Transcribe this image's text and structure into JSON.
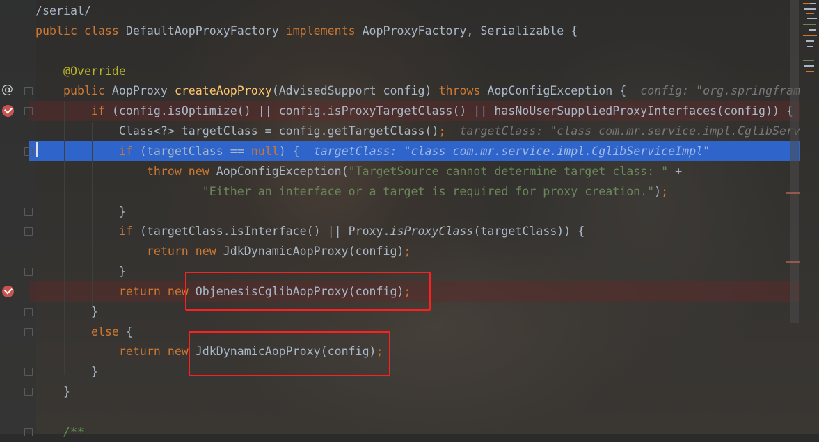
{
  "editor": {
    "lines": [
      {
        "id": "l0",
        "segments": [
          {
            "t": "/serial/",
            "c": "plain"
          }
        ]
      },
      {
        "id": "l1",
        "segments": [
          {
            "t": "public class ",
            "c": "kw"
          },
          {
            "t": "DefaultAopProxyFactory ",
            "c": "plain"
          },
          {
            "t": "implements ",
            "c": "kw"
          },
          {
            "t": "AopProxyFactory, Serializable {",
            "c": "plain"
          }
        ]
      },
      {
        "id": "l2",
        "segments": []
      },
      {
        "id": "l3",
        "segments": [
          {
            "t": "    ",
            "c": "plain"
          },
          {
            "t": "@Override",
            "c": "an"
          }
        ]
      },
      {
        "id": "l4",
        "segments": [
          {
            "t": "    ",
            "c": "plain"
          },
          {
            "t": "public ",
            "c": "kw"
          },
          {
            "t": "AopProxy ",
            "c": "plain"
          },
          {
            "t": "createAopProxy",
            "c": "fn"
          },
          {
            "t": "(AdvisedSupport config) ",
            "c": "plain"
          },
          {
            "t": "throws ",
            "c": "kw"
          },
          {
            "t": "AopConfigException {  ",
            "c": "plain"
          },
          {
            "t": "config: \"org.springfram",
            "c": "hint"
          }
        ]
      },
      {
        "id": "l5",
        "segments": [
          {
            "t": "        ",
            "c": "plain"
          },
          {
            "t": "if ",
            "c": "kw"
          },
          {
            "t": "(config.isOptimize() || config.isProxyTargetClass() || hasNoUserSuppliedProxyInterfaces(config)) {",
            "c": "plain"
          }
        ]
      },
      {
        "id": "l6",
        "segments": [
          {
            "t": "            Class<?> targetClass = config.getTargetClass()",
            "c": "plain"
          },
          {
            "t": ";",
            "c": "kw"
          },
          {
            "t": "  ",
            "c": "plain"
          },
          {
            "t": "targetClass: \"class com.mr.service.impl.CglibServ",
            "c": "hint"
          }
        ]
      },
      {
        "id": "l7",
        "segments": [
          {
            "t": "            ",
            "c": "plain"
          },
          {
            "t": "if ",
            "c": "kw"
          },
          {
            "t": "(targetClass == ",
            "c": "plain"
          },
          {
            "t": "null",
            "c": "kw"
          },
          {
            "t": ") {  ",
            "c": "plain"
          },
          {
            "t": "targetClass: \"class com.mr.service.impl.CglibServiceImpl\"",
            "c": "hint-cur"
          }
        ]
      },
      {
        "id": "l8",
        "segments": [
          {
            "t": "                ",
            "c": "plain"
          },
          {
            "t": "throw new ",
            "c": "kw"
          },
          {
            "t": "AopConfigException(",
            "c": "plain"
          },
          {
            "t": "\"TargetSource cannot determine target class: \" ",
            "c": "str"
          },
          {
            "t": "+",
            "c": "plain"
          }
        ]
      },
      {
        "id": "l9",
        "segments": [
          {
            "t": "                        ",
            "c": "plain"
          },
          {
            "t": "\"Either an interface or a target is required for proxy creation.\"",
            "c": "str"
          },
          {
            "t": ")",
            "c": "plain"
          },
          {
            "t": ";",
            "c": "kw"
          }
        ]
      },
      {
        "id": "l10",
        "segments": [
          {
            "t": "            }",
            "c": "plain"
          }
        ]
      },
      {
        "id": "l11",
        "segments": [
          {
            "t": "            ",
            "c": "plain"
          },
          {
            "t": "if ",
            "c": "kw"
          },
          {
            "t": "(targetClass.isInterface() || Proxy.",
            "c": "plain"
          },
          {
            "t": "isProxyClass",
            "c": "it"
          },
          {
            "t": "(targetClass)) {",
            "c": "plain"
          }
        ]
      },
      {
        "id": "l12",
        "segments": [
          {
            "t": "                ",
            "c": "plain"
          },
          {
            "t": "return new ",
            "c": "kw"
          },
          {
            "t": "JdkDynamicAopProxy(config)",
            "c": "plain"
          },
          {
            "t": ";",
            "c": "kw"
          }
        ]
      },
      {
        "id": "l13",
        "segments": [
          {
            "t": "            }",
            "c": "plain"
          }
        ]
      },
      {
        "id": "l14",
        "segments": [
          {
            "t": "            ",
            "c": "plain"
          },
          {
            "t": "return new ",
            "c": "kw"
          },
          {
            "t": "ObjenesisCglibAopProxy(config)",
            "c": "plain"
          },
          {
            "t": ";",
            "c": "kw"
          }
        ]
      },
      {
        "id": "l15",
        "segments": [
          {
            "t": "        }",
            "c": "plain"
          }
        ]
      },
      {
        "id": "l16",
        "segments": [
          {
            "t": "        ",
            "c": "plain"
          },
          {
            "t": "else ",
            "c": "kw"
          },
          {
            "t": "{",
            "c": "plain"
          }
        ]
      },
      {
        "id": "l17",
        "segments": [
          {
            "t": "            ",
            "c": "plain"
          },
          {
            "t": "return new ",
            "c": "kw"
          },
          {
            "t": "JdkDynamicAopProxy(config)",
            "c": "plain"
          },
          {
            "t": ";",
            "c": "kw"
          }
        ]
      },
      {
        "id": "l18",
        "segments": [
          {
            "t": "        }",
            "c": "plain"
          }
        ]
      },
      {
        "id": "l19",
        "segments": [
          {
            "t": "    }",
            "c": "plain"
          }
        ]
      },
      {
        "id": "l20",
        "segments": []
      },
      {
        "id": "l21",
        "segments": [
          {
            "t": "    ",
            "c": "plain"
          },
          {
            "t": "/**",
            "c": "cmt"
          }
        ]
      }
    ]
  },
  "gutter": {
    "override_icon": "at-sign-icon",
    "breakpoint_icon": "breakpoint-verified-icon",
    "fold_icon": "fold-marker-icon"
  },
  "colors": {
    "keyword": "#cc7832",
    "method": "#ffc66d",
    "annotation": "#bbb529",
    "string": "#6a8759",
    "breakpoint": "#c75450",
    "execution_line": "#2f65ca",
    "highlight_box": "#ff1f1f"
  }
}
